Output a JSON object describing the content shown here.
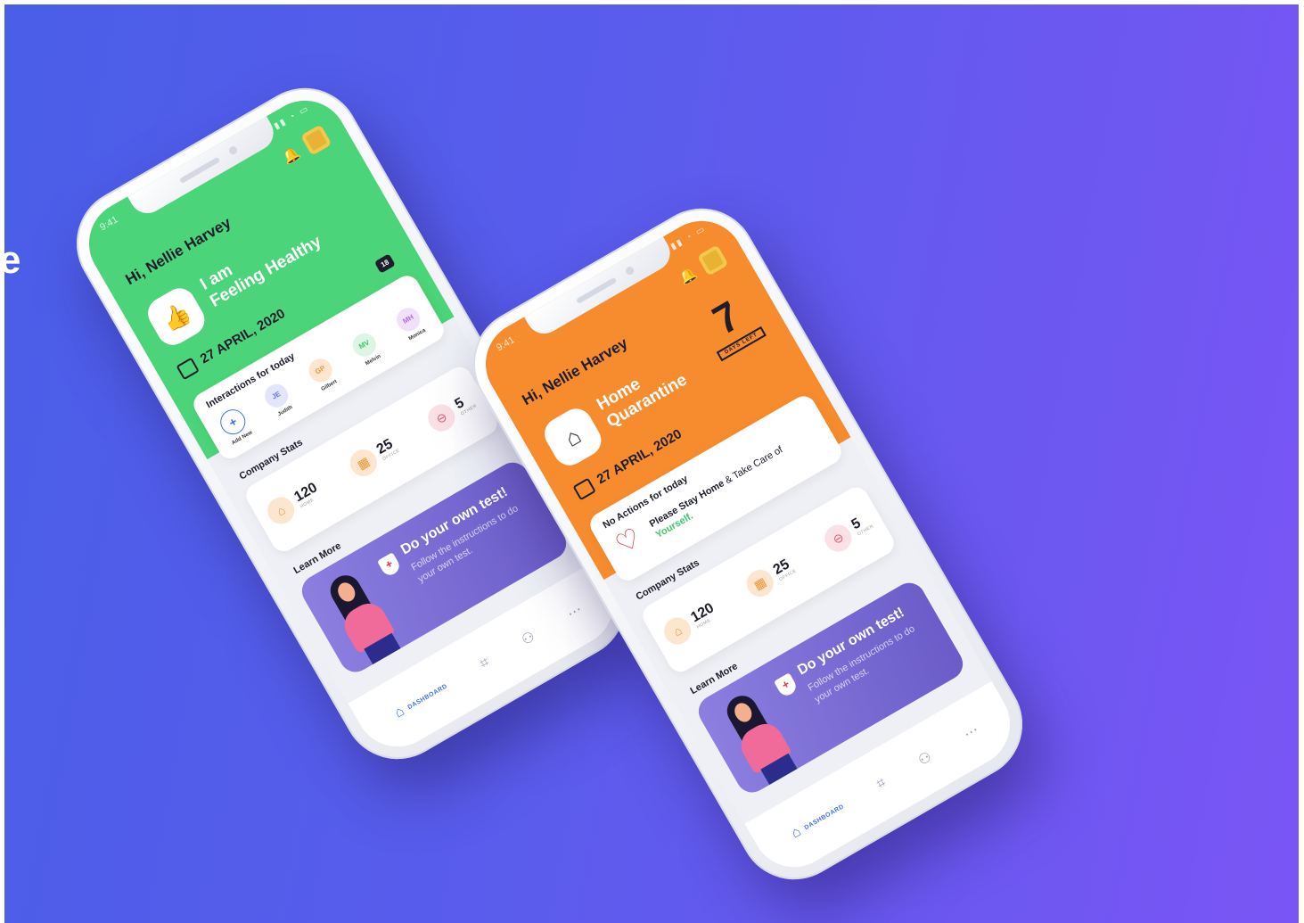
{
  "background": {
    "colors": {
      "start": "#4a5ee8",
      "end": "#7a55f5"
    },
    "edge_letter": "e"
  },
  "phones": {
    "healthy": {
      "status_time": "9:41",
      "greeting": "Hi, Nellie Harvey",
      "status_line1": "I am",
      "status_line2": "Feeling Healthy",
      "status_icon": "thumbs-up-icon",
      "header_color": "#4cd47a",
      "date": "27 APRIL, 2020",
      "interactions_title": "Interactions for today",
      "counter_badge": "18",
      "contacts": [
        {
          "initials": "+",
          "name": "Add New"
        },
        {
          "initials": "JE",
          "name": "Judith"
        },
        {
          "initials": "GP",
          "name": "Gilbert"
        },
        {
          "initials": "MV",
          "name": "Melvin"
        },
        {
          "initials": "MH",
          "name": "Monica"
        }
      ],
      "stats_title": "Company Stats",
      "stats": [
        {
          "value": "120",
          "label": "HOME"
        },
        {
          "value": "25",
          "label": "OFFICE"
        },
        {
          "value": "5",
          "label": "OTHER"
        }
      ],
      "learn_more_title": "Learn More",
      "banner_title": "Do your own test!",
      "banner_sub": "Follow the instructions to do your own test.",
      "nav": {
        "dashboard": "DASHBOARD"
      }
    },
    "quarantine": {
      "status_time": "9:41",
      "greeting": "Hi, Nellie Harvey",
      "status_line1": "Home",
      "status_line2": "Quarantine",
      "status_icon": "home-icon",
      "header_color": "#f68c2e",
      "days_count": "7",
      "days_label": "DAYS LEFT",
      "date": "27 APRIL, 2020",
      "actions_title": "No Actions for today",
      "message_part1": "Please Stay Home",
      "message_part2": " & Take Care of",
      "message_highlight": "Yourself.",
      "stats_title": "Company Stats",
      "stats": [
        {
          "value": "120",
          "label": "HOME"
        },
        {
          "value": "25",
          "label": "OFFICE"
        },
        {
          "value": "5",
          "label": "OTHER"
        }
      ],
      "learn_more_title": "Learn More",
      "banner_title": "Do your own test!",
      "banner_sub": "Follow the instructions to do your own test.",
      "nav": {
        "dashboard": "DASHBOARD"
      }
    }
  }
}
